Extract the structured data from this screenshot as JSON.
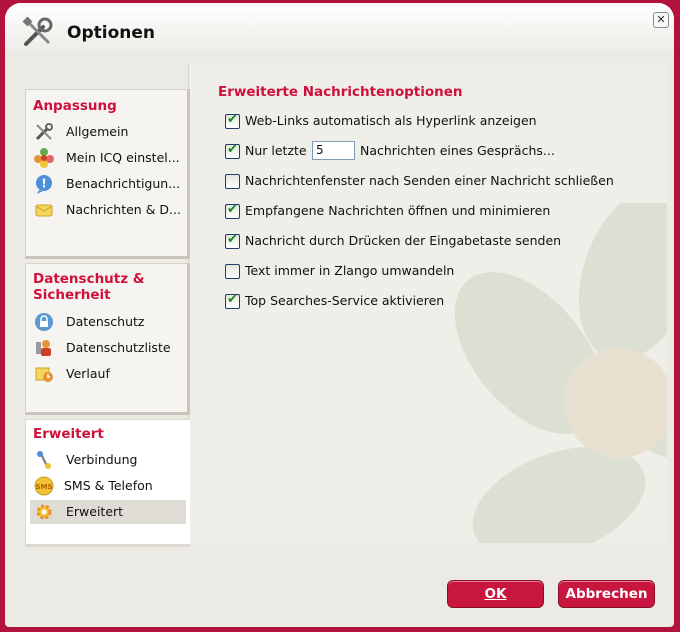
{
  "window": {
    "title": "Optionen",
    "close_icon": "close-icon"
  },
  "sidebar": {
    "groups": [
      {
        "title": "Anpassung",
        "items": [
          {
            "label": "Allgemein",
            "icon": "tools-icon"
          },
          {
            "label": "Mein ICQ einstel...",
            "icon": "flower-icon"
          },
          {
            "label": "Benachrichtigun...",
            "icon": "info-icon"
          },
          {
            "label": "Nachrichten & D...",
            "icon": "message-icon"
          }
        ]
      },
      {
        "title": "Datenschutz & Sicherheit",
        "items": [
          {
            "label": "Datenschutz",
            "icon": "lock-icon"
          },
          {
            "label": "Datenschutzliste",
            "icon": "user-list-icon"
          },
          {
            "label": "Verlauf",
            "icon": "history-icon"
          }
        ]
      },
      {
        "title": "Erweitert",
        "items": [
          {
            "label": "Verbindung",
            "icon": "connection-icon"
          },
          {
            "label": "SMS & Telefon",
            "icon": "sms-icon"
          },
          {
            "label": "Erweitert",
            "icon": "gear-icon",
            "selected": true
          }
        ]
      }
    ]
  },
  "main": {
    "section_title": "Erweiterte Nachrichtenoptionen",
    "options": [
      {
        "label": "Web-Links automatisch als Hyperlink anzeigen",
        "checked": true
      },
      {
        "label": "Nur letzte",
        "checked": true,
        "input_value": "5",
        "after_label": "Nachrichten eines Gesprächs..."
      },
      {
        "label": "Nachrichtenfenster nach Senden einer Nachricht schließen",
        "checked": false
      },
      {
        "label": "Empfangene Nachrichten öffnen und minimieren",
        "checked": true
      },
      {
        "label": "Nachricht durch Drücken der Eingabetaste senden",
        "checked": true
      },
      {
        "label": "Text immer in Zlango umwandeln",
        "checked": false
      },
      {
        "label": "Top Searches-Service aktivieren",
        "checked": true
      }
    ]
  },
  "buttons": {
    "ok": "OK",
    "cancel": "Abbrechen"
  },
  "colors": {
    "accent": "#d0103c",
    "frame": "#b3123c",
    "check": "#1a8a1a"
  }
}
